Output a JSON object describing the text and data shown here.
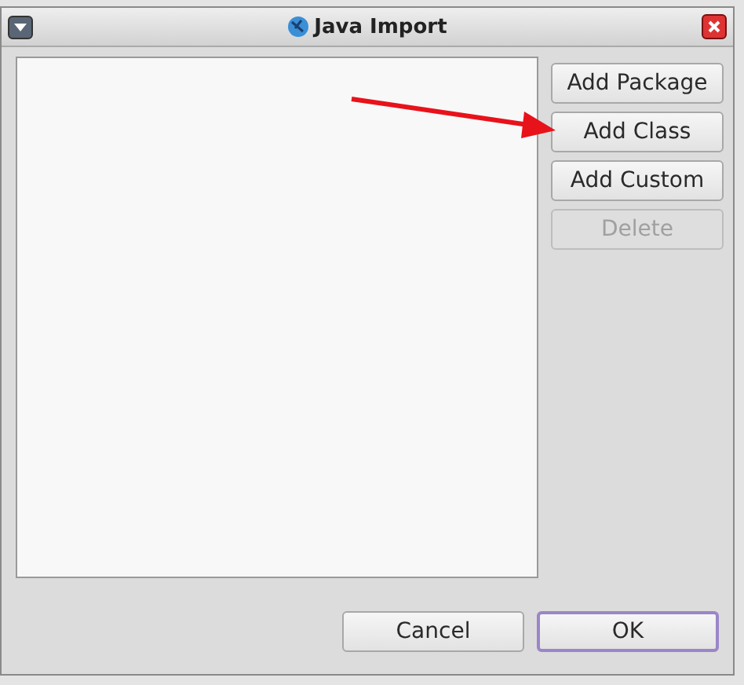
{
  "window": {
    "title": "Java Import"
  },
  "side_buttons": [
    {
      "label": "Add Package",
      "disabled": false
    },
    {
      "label": "Add Class",
      "disabled": false
    },
    {
      "label": "Add Custom",
      "disabled": false
    },
    {
      "label": "Delete",
      "disabled": true
    }
  ],
  "footer_buttons": [
    {
      "label": "Cancel",
      "focused": false
    },
    {
      "label": "OK",
      "focused": true
    }
  ]
}
